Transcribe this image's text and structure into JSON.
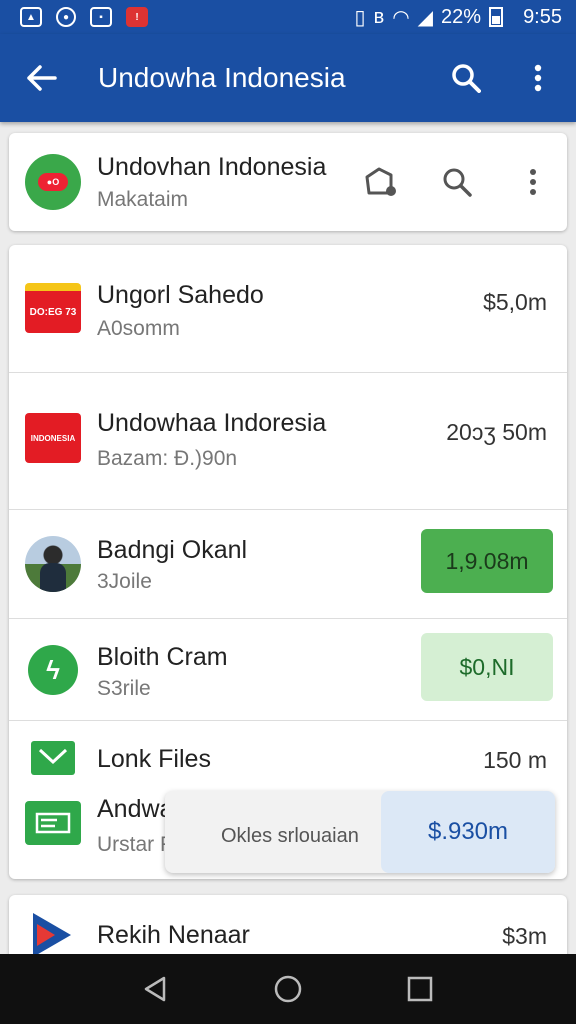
{
  "status_bar": {
    "battery": "22%",
    "time": "9:55",
    "carrier_glyph": "ʙ"
  },
  "app_bar": {
    "title": "Undowha Indonesia"
  },
  "header_card": {
    "title": "Undovhan Indonesia",
    "subtitle": "Makataim"
  },
  "list": [
    {
      "title": "Ungorl Sahedo",
      "subtitle": "A0somm",
      "amount": "$5,0m",
      "icon_text": "DO:EG 73"
    },
    {
      "title": "Undowhaa Indoresia",
      "subtitle": "Bazam: Ð.)90n",
      "amount": "20ɔʒ 50m",
      "icon_text": "INDONESIA"
    },
    {
      "title": "Badngi Okanl",
      "subtitle": "3Joile",
      "amount": "1,9.08m"
    },
    {
      "title": "Bloith Cram",
      "subtitle": "S3rile",
      "amount": "$0,NI"
    },
    {
      "title": "Lonk Files",
      "amount": "150 m"
    },
    {
      "title": "Andwaan Indoorressa",
      "subtitle": "Urstar File",
      "popup_label": "Okles srlouaian",
      "amount": "$.930m"
    }
  ],
  "bottom_card": {
    "title": "Rekih Nenaar",
    "amount": "$3m"
  },
  "colors": {
    "primary": "#1a4fa3",
    "accent_green": "#4caf50",
    "red": "#e31c24"
  }
}
